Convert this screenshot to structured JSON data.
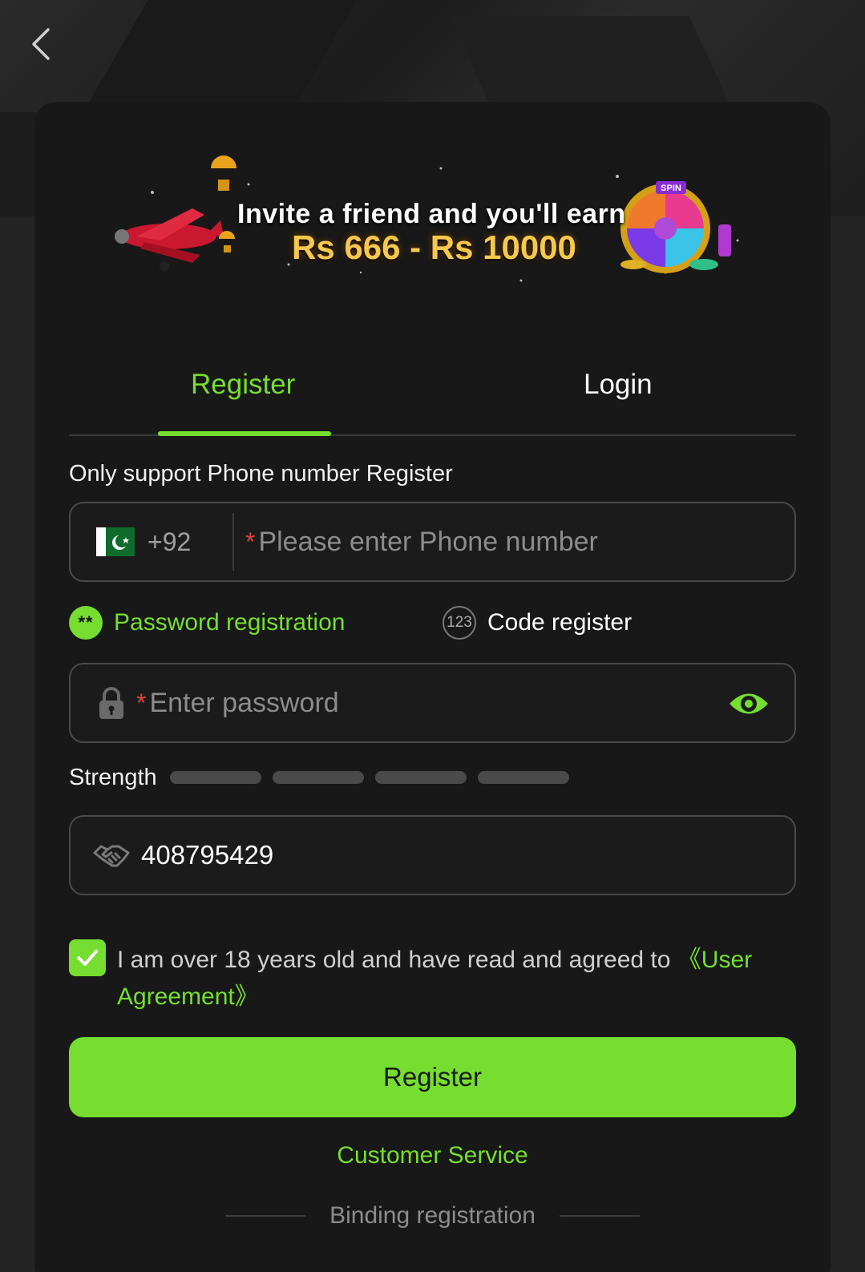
{
  "banner": {
    "line1": "Invite a friend and you'll earn",
    "line2": "Rs 666 - Rs 10000",
    "wheel_label": "SPIN"
  },
  "tabs": [
    {
      "label": "Register",
      "active": true
    },
    {
      "label": "Login",
      "active": false
    }
  ],
  "form": {
    "hint": "Only support Phone number Register",
    "phone": {
      "country_code": "+92",
      "required_mark": "*",
      "placeholder": "Please enter Phone number"
    },
    "modes": [
      {
        "label": "Password registration",
        "icon_text": "**",
        "active": true
      },
      {
        "label": "Code register",
        "icon_text": "123",
        "active": false
      }
    ],
    "password": {
      "required_mark": "*",
      "placeholder": "Enter password"
    },
    "strength": {
      "label": "Strength",
      "bars": 4,
      "filled": 0
    },
    "invite_code": {
      "value": "408795429"
    },
    "agreement": {
      "checked": true,
      "text": "I am over 18 years old and have read and agreed to ",
      "link": "《User Agreement》"
    },
    "submit_label": "Register"
  },
  "footer": {
    "customer_service": "Customer Service",
    "binding": "Binding registration"
  },
  "colors": {
    "accent": "#75de30",
    "required": "#e34040",
    "card": "#181818",
    "background": "#242424"
  },
  "icons": {
    "back": "chevron-left-icon",
    "flag": "pakistan-flag-icon",
    "lock": "lock-icon",
    "eye": "eye-icon",
    "invite": "handshake-icon",
    "check": "check-icon"
  }
}
